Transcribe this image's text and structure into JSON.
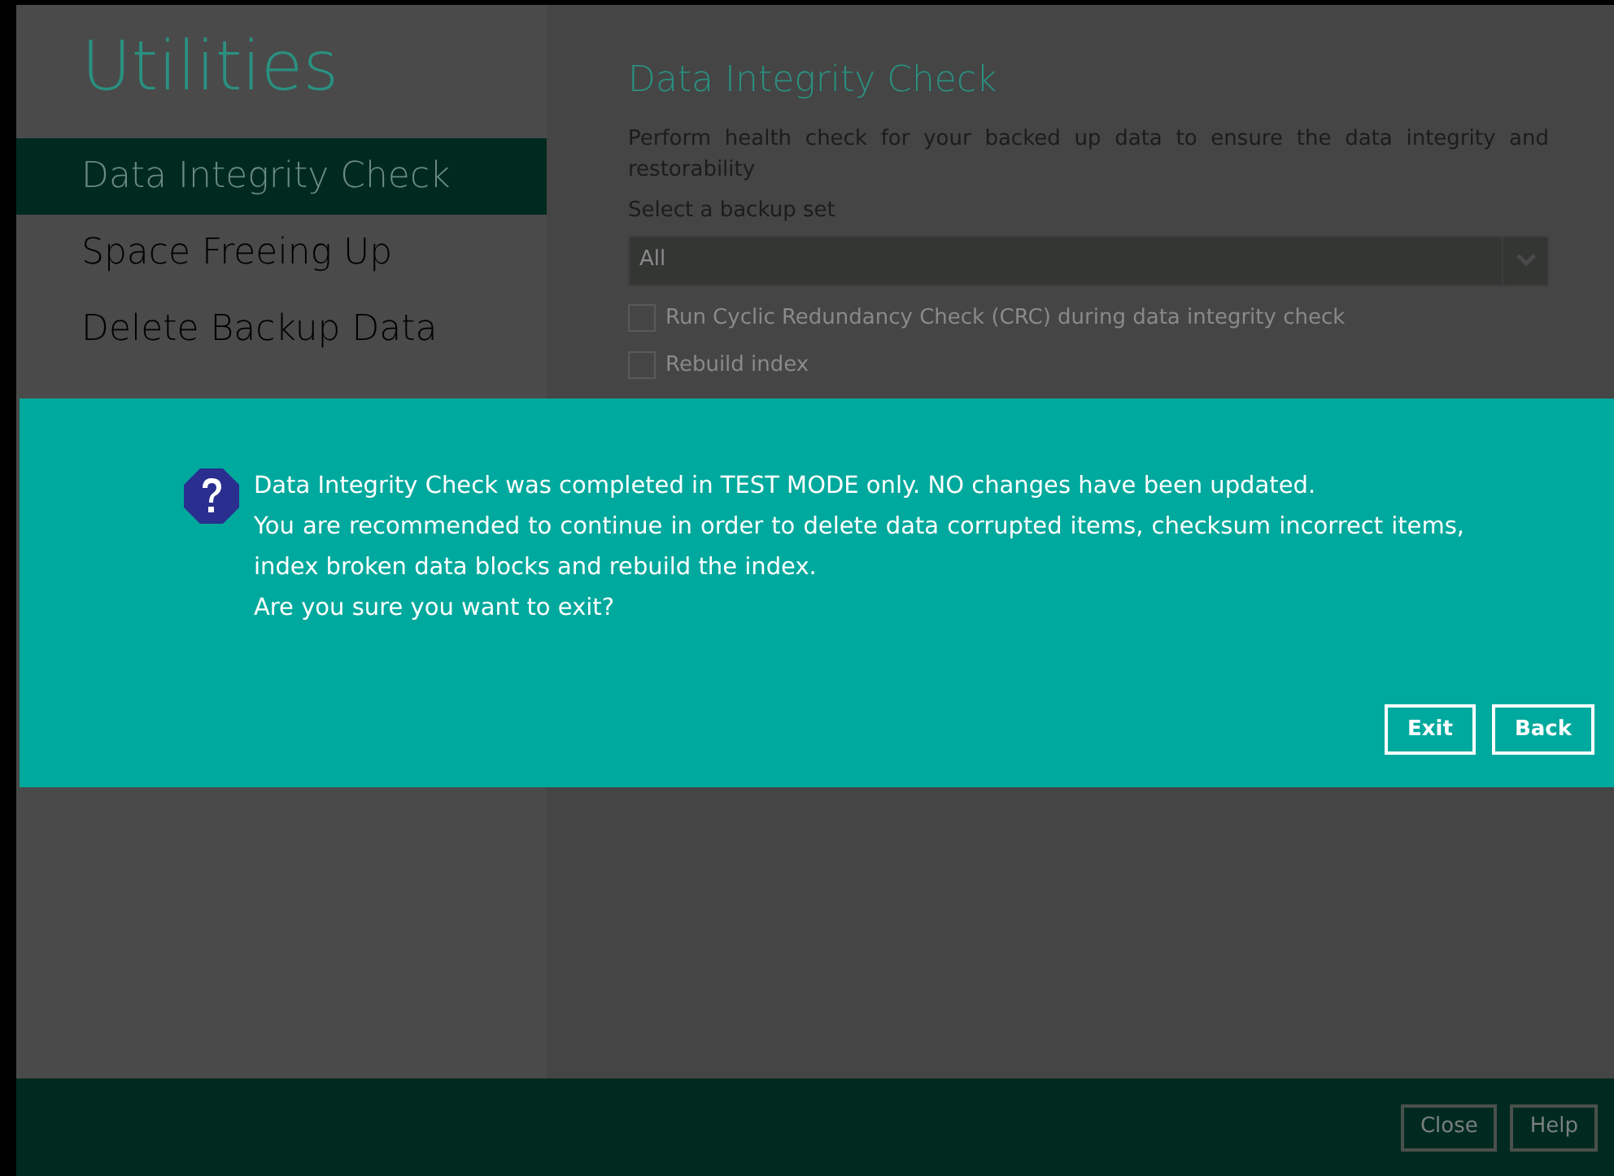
{
  "sidebar": {
    "title": "Utilities",
    "items": [
      {
        "label": "Data Integrity Check",
        "selected": true
      },
      {
        "label": "Space Freeing Up",
        "selected": false
      },
      {
        "label": "Delete Backup Data",
        "selected": false
      }
    ]
  },
  "main": {
    "heading": "Data Integrity Check",
    "description": "Perform health check for your backed up data to ensure the data integrity and restorability",
    "select_label": "Select a backup set",
    "select_value": "All",
    "options": [
      {
        "label": "Run Cyclic Redundancy Check (CRC) during data integrity check",
        "checked": false
      },
      {
        "label": "Rebuild index",
        "checked": false
      }
    ]
  },
  "dialog": {
    "lines": [
      "Data Integrity Check was completed in TEST MODE only. NO changes have been updated.",
      "You are recommended to continue in order to delete data corrupted items, checksum incorrect items, index broken data blocks and rebuild the index.",
      "Are you sure you want to exit?"
    ],
    "buttons": [
      "Exit",
      "Back"
    ]
  },
  "footer": {
    "buttons": [
      "Close",
      "Help"
    ]
  }
}
